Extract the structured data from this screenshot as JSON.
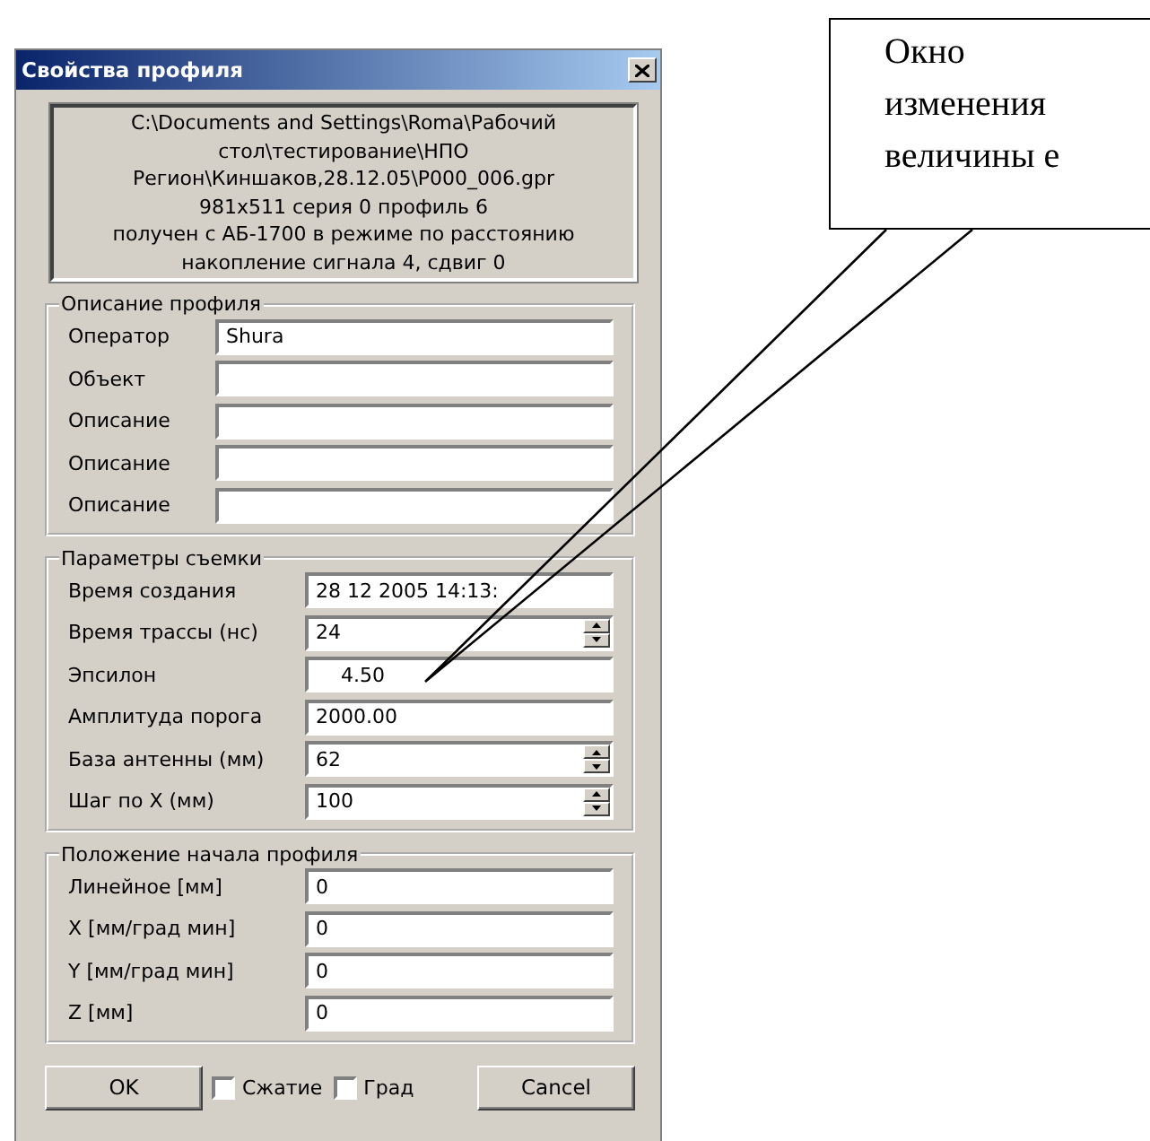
{
  "window": {
    "title": "Свойства профиля"
  },
  "info": [
    "C:\\Documents and Settings\\Roma\\Рабочий",
    "стол\\тестирование\\НПО",
    "Регион\\Киншаков,28.12.05\\P000_006.gpr",
    "981x511 серия 0 профиль 6",
    "получен с АБ-1700 в режиме по расстоянию",
    "накопление сигнала 4, сдвиг 0"
  ],
  "groups": [
    {
      "title": "Описание профиля",
      "rows": [
        {
          "label": "Оператор",
          "value": "Shura",
          "kind": "text"
        },
        {
          "label": "Объект",
          "kind": "text"
        },
        {
          "label": "Описание",
          "kind": "text"
        },
        {
          "label": "Описание",
          "kind": "text"
        },
        {
          "label": "Описание",
          "kind": "text"
        }
      ]
    },
    {
      "title": "Параметры съемки",
      "rows": [
        {
          "label": "Время создания",
          "value": "28 12 2005 14:13:",
          "kind": "text"
        },
        {
          "label": "Время трассы (нс)",
          "value": "24",
          "kind": "spin"
        },
        {
          "label": "Эпсилон",
          "value": "4.50",
          "kind": "indented"
        },
        {
          "label": "Амплитуда порога",
          "value": "2000.00",
          "kind": "text"
        },
        {
          "label": "База антенны (мм)",
          "value": "62",
          "kind": "spin"
        },
        {
          "label": "Шаг по X (мм)",
          "value": "100",
          "kind": "spin"
        }
      ]
    },
    {
      "title": "Положение начала профиля",
      "rows": [
        {
          "label": "Линейное [мм]",
          "value": "0",
          "kind": "text"
        },
        {
          "label": "X [мм/град мин]",
          "value": "0",
          "kind": "text"
        },
        {
          "label": "Y [мм/град мин]",
          "value": "0",
          "kind": "text"
        },
        {
          "label": "Z [мм]",
          "value": "0",
          "kind": "text"
        }
      ]
    }
  ],
  "footer": {
    "ok": "OK",
    "checkboxes": [
      {
        "label": "Сжатие",
        "checked": false
      },
      {
        "label": "Град",
        "checked": false
      }
    ],
    "cancel": "Cancel"
  },
  "callout": {
    "text": "Окно изменения величины е"
  }
}
